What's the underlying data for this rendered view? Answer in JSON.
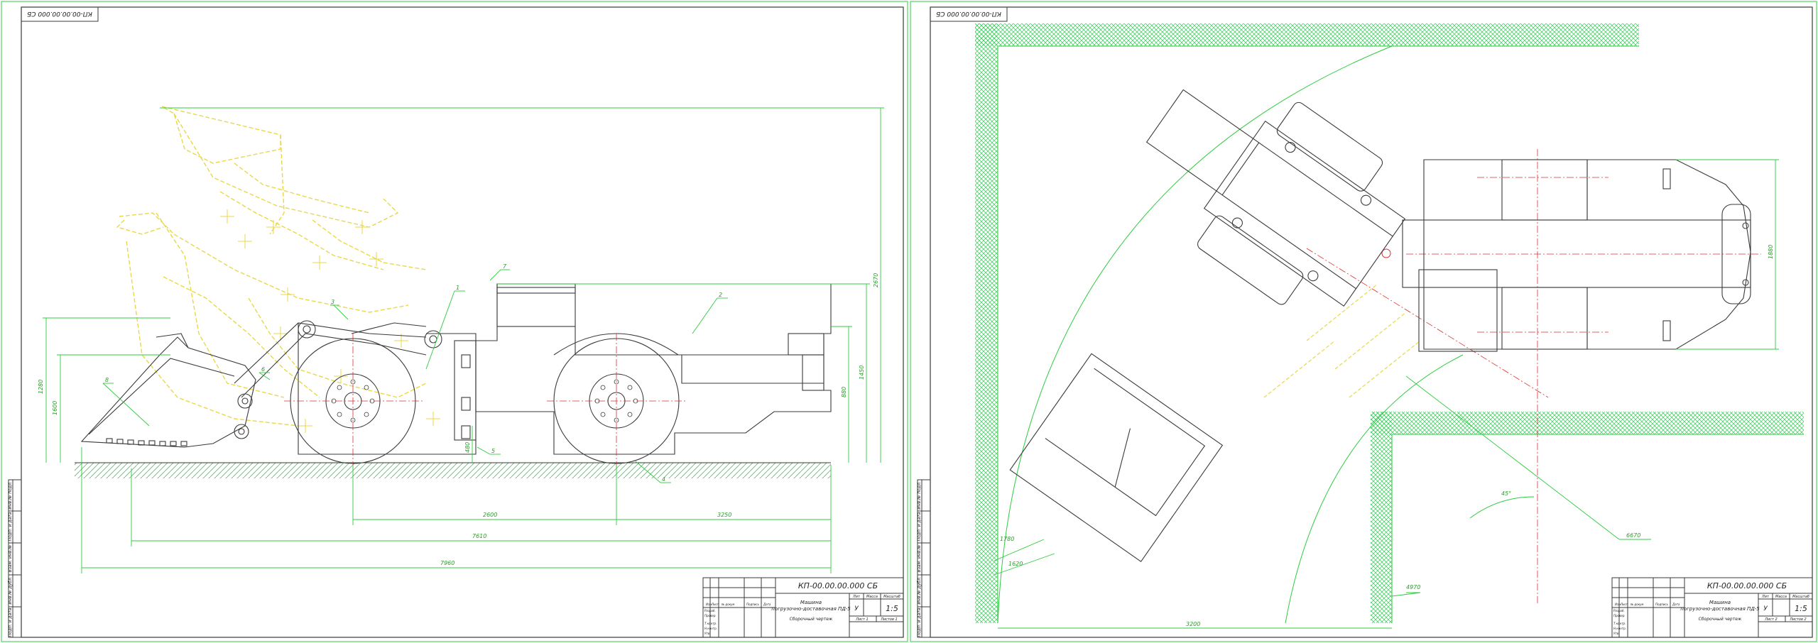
{
  "colors": {
    "outline": "#3a3a3a",
    "green": "#2ecc40",
    "yellow": "#e8d84a",
    "red": "#d93030",
    "hatch": "#33cc55"
  },
  "sheets": [
    {
      "corner_code": "КП-00.00.00.000 СБ",
      "title_block": {
        "doc_code": "КП-00.00.00.000 СБ",
        "name_line1": "Машина",
        "name_line2": "погрузочно-доставочная ПД-5",
        "name_line3": "Сборочный чертеж",
        "lit": "У",
        "scale": "1:5",
        "headers": [
          "Лит",
          "Масса",
          "Масштаб"
        ],
        "row_labels": [
          "Изм",
          "Лист",
          "№ докум",
          "Подпись",
          "Дата"
        ],
        "sheet_label": "Лист 1",
        "sheets_label": "Листов 1",
        "people": [
          "Разраб.",
          "Провер.",
          "Т.контр.",
          "Н.контр.",
          "Утв."
        ]
      },
      "side_stamps": [
        "Инв.№ подл.",
        "Подп. и дата",
        "Взам. инв.№",
        "Инв.№ дубл.",
        "Подп. и дата"
      ],
      "leaders": [
        "1",
        "2",
        "3",
        "4",
        "5",
        "6",
        "7",
        "8"
      ],
      "dims": [
        "2600",
        "3250",
        "7610",
        "7960",
        "1280",
        "1600",
        "2670",
        "1450",
        "880",
        "480"
      ]
    },
    {
      "corner_code": "КП-00.00.00.000 СБ",
      "title_block": {
        "doc_code": "КП-00.00.00.000 СБ",
        "name_line1": "Машина",
        "name_line2": "погрузочно-доставочная ПД-5",
        "name_line3": "Сборочный чертеж",
        "lit": "У",
        "scale": "1:5",
        "headers": [
          "Лит",
          "Масса",
          "Масштаб"
        ],
        "row_labels": [
          "Изм",
          "Лист",
          "№ докум",
          "Подпись",
          "Дата"
        ],
        "sheet_label": "Лист 2",
        "sheets_label": "Листов 2",
        "people": [
          "Разраб.",
          "Провер.",
          "Т.контр.",
          "Н.контр.",
          "Утв."
        ]
      },
      "side_stamps": [
        "Инв.№ подл.",
        "Подп. и дата",
        "Взам. инв.№",
        "Инв.№ дубл.",
        "Подп. и дата"
      ],
      "dims": [
        "1780",
        "6670",
        "4970",
        "3200",
        "1880",
        "1620",
        "45°"
      ]
    }
  ]
}
